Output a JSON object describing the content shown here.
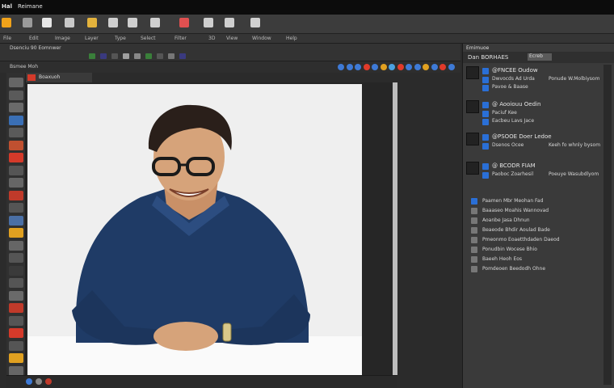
{
  "window": {
    "title_left": "Hal",
    "title_right": "Reimane"
  },
  "toolbar_icons": [
    {
      "name": "app-logo-icon",
      "color": "#f0a21a"
    },
    {
      "name": "file-icon",
      "color": "#9a9a9a"
    },
    {
      "name": "new-icon",
      "color": "#e6e6e6"
    },
    {
      "name": "grid-icon",
      "color": "#c9c9c9"
    },
    {
      "name": "pin-icon",
      "color": "#e3b23c"
    },
    {
      "name": "tool-icon",
      "color": "#cfcfcf"
    },
    {
      "name": "layer-icon",
      "color": "#cfcfcf"
    },
    {
      "name": "eye-icon",
      "color": "#cfcfcf"
    },
    {
      "name": "record-icon",
      "color": "#e05050"
    },
    {
      "name": "camera-icon",
      "color": "#cfcfcf"
    },
    {
      "name": "monitor-icon",
      "color": "#cfcfcf"
    },
    {
      "name": "folder-icon",
      "color": "#d0d0d0"
    }
  ],
  "menubar": {
    "items": [
      "File",
      "Edit",
      "Image",
      "Layer",
      "Type",
      "Select",
      "Filter",
      "3D",
      "View",
      "Window",
      "Help"
    ]
  },
  "options": {
    "label": "Dsenciu 90 Eomnwer",
    "chip_colors": [
      "#3a7f3a",
      "#3a3a7f",
      "#555",
      "#a0a0a0",
      "#888",
      "#3a7f3a",
      "#555",
      "#777",
      "#3a3a7f"
    ]
  },
  "document": {
    "tab_label": "Boaxuoh",
    "path_label": "Bsmee Moh",
    "control_dots": [
      "#3e7ad6",
      "#3e7ad6",
      "#3e7ad6",
      "#e03a2a",
      "#3e7ad6",
      "#e0a020",
      "#4aa0e0",
      "#e03a2a",
      "#3e7ad6",
      "#3e7ad6",
      "#e0a020",
      "#3e7ad6",
      "#e03a2a",
      "#3e7ad6"
    ]
  },
  "tools": {
    "tool_colors": [
      "#666",
      "#5a5a5a",
      "#6a6a6a",
      "#3a6fb5",
      "#5a5a5a",
      "#c05030",
      "#d43a2a",
      "#555",
      "#666",
      "#c03a2a",
      "#555",
      "#4a6fa5",
      "#e0a020",
      "#666",
      "#555",
      "#3a3a3a",
      "#555",
      "#6a6a6a",
      "#c03a2a",
      "#555",
      "#d43a2a",
      "#555",
      "#e0a020",
      "#666"
    ]
  },
  "status": {
    "dots": [
      "#3e7ad6",
      "#888",
      "#c03a2a"
    ]
  },
  "panel": {
    "header": "Emimuoe",
    "tab_title": "Dan BORHAES",
    "tab_button": "Ecreb",
    "groups": [
      {
        "title": "@FNCEE Oudow",
        "lines": [
          "Dwvocds Ad Urda",
          "Pavoe & Baase"
        ],
        "right": "Ponude W.Molbiysom",
        "accent": "#2a6fd6"
      },
      {
        "title": "@ Aooiouu Oedin",
        "lines": [
          "Paciuf Kee",
          "Eacbeu Lavs Jace"
        ],
        "right": "",
        "accent": "#2a6fd6"
      },
      {
        "title": "@PSOOE Doer Ledoe",
        "lines": [
          "Dsenos Ocee"
        ],
        "right": "Keeh fo whnly bysom",
        "accent": "#2a6fd6"
      },
      {
        "title": "@ BCODR FIAM",
        "lines": [
          "Paoboc Zoarhesil"
        ],
        "right": "Poeuye Wasubdlyom",
        "accent": "#2a6fd6"
      }
    ],
    "list": [
      "Paamen Mbr Meohan Fad",
      "Baaaseo Moahis Wannovad",
      "Aoanbe Jasa Dhnun",
      "Beaeode Bhdir Aoulad Bade",
      "Pmeonmo Eoaetthdaden Daeod",
      "Ponudbin Wocese Bhio",
      "Baeeh Heoh Eos",
      "Pomdeoen Beedodh Ohne"
    ]
  }
}
